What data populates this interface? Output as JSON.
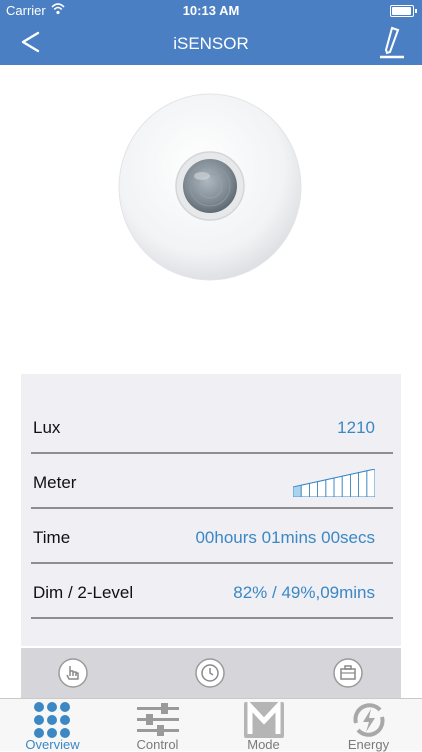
{
  "status_bar": {
    "carrier": "Carrier",
    "time": "10:13 AM"
  },
  "nav": {
    "title": "iSENSOR",
    "back_icon": "chevron-left-icon",
    "edit_icon": "pencil-icon"
  },
  "device": {
    "image": "motion-sensor-image"
  },
  "readings": [
    {
      "label": "Lux",
      "value": "1210"
    },
    {
      "label": "Meter",
      "value": null,
      "meter_level": 0.1,
      "meter_segments": 10
    },
    {
      "label": "Time",
      "value": "00hours 01mins 00secs"
    },
    {
      "label": "Dim / 2-Level",
      "value": "82% / 49%,09mins"
    }
  ],
  "actions": [
    {
      "icon": "touch-icon"
    },
    {
      "icon": "clock-icon"
    },
    {
      "icon": "toolbox-icon"
    }
  ],
  "tabs": [
    {
      "label": "Overview",
      "icon": "grid-dots-icon",
      "active": true
    },
    {
      "label": "Control",
      "icon": "sliders-icon",
      "active": false
    },
    {
      "label": "Mode",
      "icon": "mode-m-icon",
      "active": false
    },
    {
      "label": "Energy",
      "icon": "energy-icon",
      "active": false
    }
  ],
  "colors": {
    "accent": "#4b7fc3",
    "value_text": "#3b88c4",
    "panel_bg": "#efeff4"
  }
}
